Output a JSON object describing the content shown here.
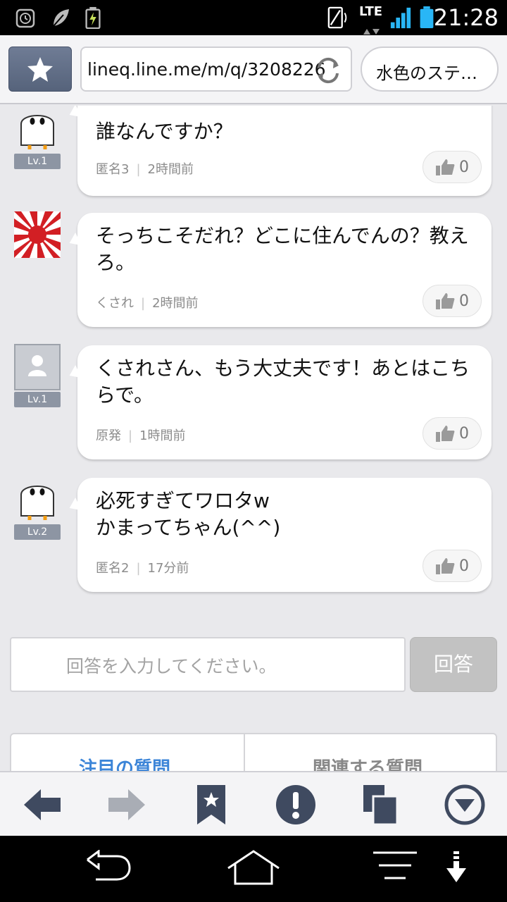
{
  "status_bar": {
    "time": "21:28",
    "network": "LTE"
  },
  "browser": {
    "url": "lineq.line.me/m/q/3208226",
    "tab_title": "水色のステ…"
  },
  "answers": [
    {
      "text": "誰なんですか？",
      "user": "匿名3",
      "time": "2時間前",
      "likes": "0",
      "level": "Lv.1",
      "avatar": "ghost-avatar"
    },
    {
      "text": "そっちこそだれ？どこに住んでんの？教えろ。",
      "user": "くされ",
      "time": "2時間前",
      "likes": "0",
      "level": "",
      "avatar": "rising-sun-avatar"
    },
    {
      "text": "くされさん、もう大丈夫です！あとはこちらで。",
      "user": "原発",
      "time": "1時間前",
      "likes": "0",
      "level": "Lv.1",
      "avatar": "default-person-avatar"
    },
    {
      "text": "必死すぎてワロタw\nかまってちゃん(^^)",
      "user": "匿名2",
      "time": "17分前",
      "likes": "0",
      "level": "Lv.2",
      "avatar": "ghost-avatar"
    }
  ],
  "answer_form": {
    "placeholder": "回答を入力してください。",
    "submit_label": "回答"
  },
  "bottom_tabs": {
    "featured": "注目の質問",
    "related": "関連する質問"
  },
  "colors": {
    "accent": "#3c85d8",
    "nav_icon": "#3f4a60",
    "background": "#e9e9ec"
  }
}
